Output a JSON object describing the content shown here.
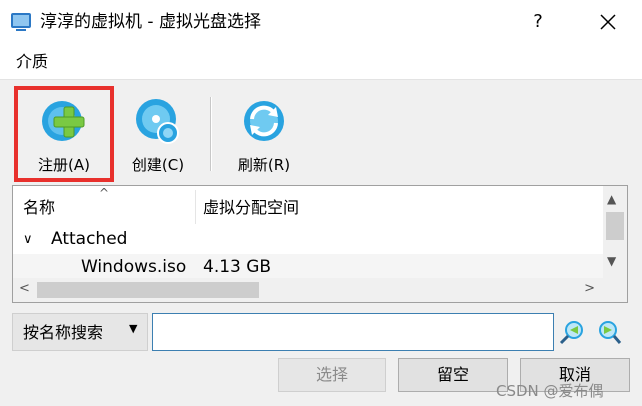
{
  "window": {
    "title": "淳淳的虚拟机 - 虚拟光盘选择",
    "help_label": "?"
  },
  "menu": {
    "items": [
      "介质"
    ]
  },
  "toolbar": {
    "register_label": "注册(A)",
    "create_label": "创建(C)",
    "refresh_label": "刷新(R)"
  },
  "tree": {
    "columns": [
      "名称",
      "虚拟分配空间"
    ],
    "groups": [
      {
        "name": "Attached",
        "items": [
          {
            "name": "Windows.iso",
            "size": "4.13 GB"
          }
        ]
      }
    ]
  },
  "search": {
    "mode_label": "按名称搜索",
    "value": ""
  },
  "buttons": {
    "choose": "选择",
    "leave_empty": "留空",
    "cancel": "取消"
  },
  "watermark": "CSDN @爱布偶",
  "colors": {
    "highlight": "#e8302c",
    "icon_blue": "#29a3e0",
    "icon_green": "#7ac943"
  }
}
